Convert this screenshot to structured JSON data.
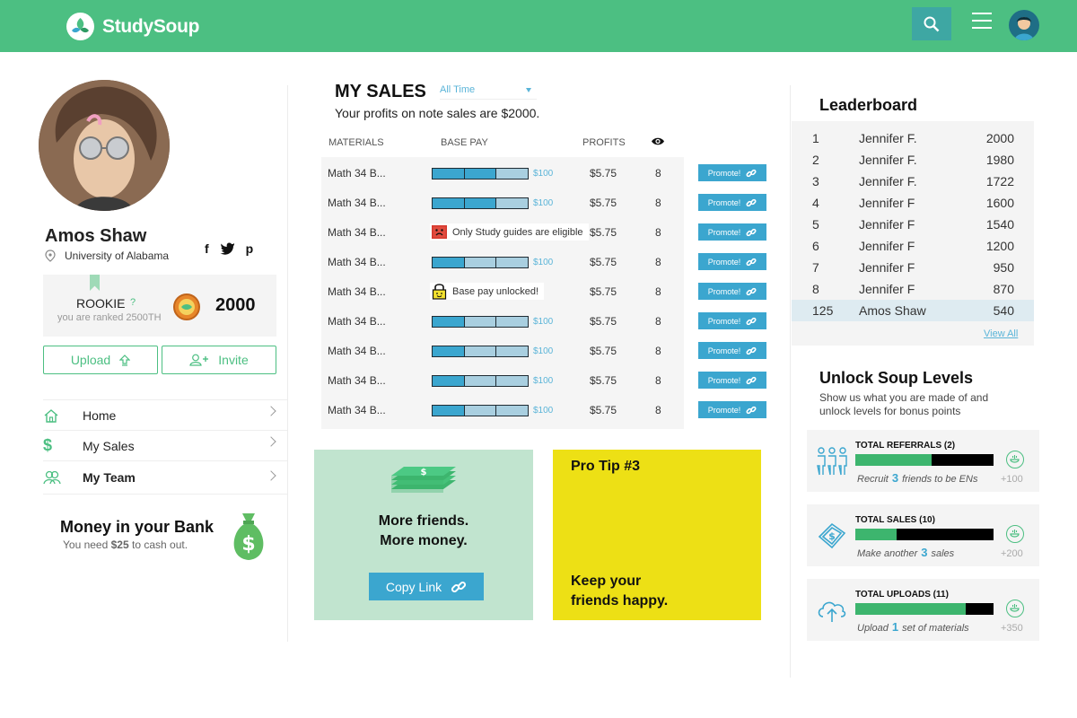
{
  "header": {
    "brand": "StudySoup",
    "colors": {
      "brand_green": "#4cbf82",
      "accent_blue": "#3ba6cf",
      "tip_yellow": "#ede015"
    }
  },
  "profile": {
    "name": "Amos Shaw",
    "school": "University of Alabama",
    "social": [
      "f",
      "t",
      "p"
    ],
    "rank_label": "ROOKIE",
    "rank_help": "?",
    "rank_sub": "you are ranked 2500TH",
    "points": "2000",
    "upload_label": "Upload",
    "invite_label": "Invite"
  },
  "nav": [
    {
      "label": "Home",
      "icon": "home-icon"
    },
    {
      "label": "My Sales",
      "icon": "dollar-icon"
    },
    {
      "label": "My Team",
      "icon": "team-icon"
    }
  ],
  "bank": {
    "title": "Money in your Bank",
    "sub_prefix": "You need",
    "amount": "$25",
    "sub_suffix": "to cash out."
  },
  "sales": {
    "title": "MY SALES",
    "period": "All Time",
    "subtitle": "Your profits on note sales are $2000.",
    "columns": [
      "MATERIALS",
      "BASE PAY",
      "PROFITS"
    ],
    "promote_label": "Promote!",
    "rows": [
      {
        "material": "Math 34 B...",
        "type": "bar",
        "fill": 0.72,
        "basepay": "$100",
        "profit": "$5.75",
        "views": "8"
      },
      {
        "material": "Math 34 B...",
        "type": "bar",
        "fill": 0.72,
        "basepay": "$100",
        "profit": "$5.75",
        "views": "8"
      },
      {
        "material": "Math 34 B...",
        "type": "note",
        "note": "Only Study guides are eligible",
        "note_icon": "sad-face-icon",
        "profit": "$5.75",
        "views": "8"
      },
      {
        "material": "Math 34 B...",
        "type": "bar",
        "fill": 0.33,
        "basepay": "$100",
        "profit": "$5.75",
        "views": "8"
      },
      {
        "material": "Math 34 B...",
        "type": "note",
        "note": "Base pay unlocked!",
        "note_icon": "lock-icon",
        "profit": "$5.75",
        "views": "8"
      },
      {
        "material": "Math 34 B...",
        "type": "bar",
        "fill": 0.33,
        "basepay": "$100",
        "profit": "$5.75",
        "views": "8"
      },
      {
        "material": "Math 34 B...",
        "type": "bar",
        "fill": 0.33,
        "basepay": "$100",
        "profit": "$5.75",
        "views": "8"
      },
      {
        "material": "Math 34 B...",
        "type": "bar",
        "fill": 0.33,
        "basepay": "$100",
        "profit": "$5.75",
        "views": "8"
      },
      {
        "material": "Math 34 B...",
        "type": "bar",
        "fill": 0.33,
        "basepay": "$100",
        "profit": "$5.75",
        "views": "8"
      }
    ]
  },
  "promo": {
    "line1": "More friends.",
    "line2": "More money.",
    "copy_label": "Copy Link",
    "tip_title": "Pro Tip #3",
    "tip_line1": "Keep your",
    "tip_line2": "friends happy."
  },
  "leaderboard": {
    "title": "Leaderboard",
    "view_all": "View All",
    "rows": [
      {
        "rank": "1",
        "name": "Jennifer F.",
        "points": "2000"
      },
      {
        "rank": "2",
        "name": "Jennifer F.",
        "points": "1980"
      },
      {
        "rank": "3",
        "name": "Jennifer F.",
        "points": "1722"
      },
      {
        "rank": "4",
        "name": "Jennifer F",
        "points": "1600"
      },
      {
        "rank": "5",
        "name": "Jennifer F",
        "points": "1540"
      },
      {
        "rank": "6",
        "name": "Jennifer F",
        "points": "1200"
      },
      {
        "rank": "7",
        "name": "Jennifer F",
        "points": "950"
      },
      {
        "rank": "8",
        "name": "Jennifer F",
        "points": "870"
      },
      {
        "rank": "125",
        "name": "Amos Shaw",
        "points": "540",
        "me": true
      }
    ]
  },
  "levels": {
    "title": "Unlock Soup Levels",
    "subtitle": "Show us what you are made of and unlock levels for bonus points",
    "items": [
      {
        "title": "TOTAL REFERRALS (2)",
        "progress": 0.55,
        "pre": "Recruit",
        "num": "3",
        "post": "friends to be ENs",
        "points": "+100",
        "icon": "people-icon"
      },
      {
        "title": "TOTAL SALES (10)",
        "progress": 0.3,
        "pre": "Make another",
        "num": "3",
        "post": "sales",
        "points": "+200",
        "icon": "money-icon"
      },
      {
        "title": "TOTAL UPLOADS (11)",
        "progress": 0.8,
        "pre": "Upload",
        "num": "1",
        "post": "set of materials",
        "points": "+350",
        "icon": "upload-cloud-icon"
      }
    ]
  }
}
